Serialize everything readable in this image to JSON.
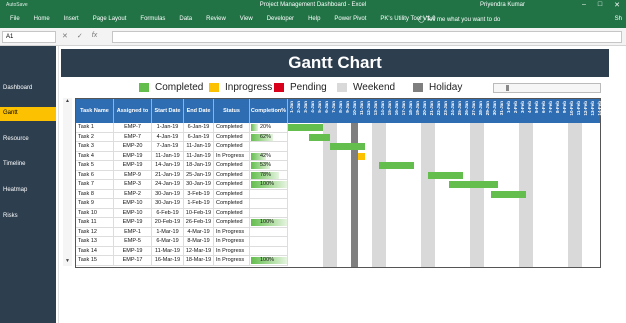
{
  "titlebar": {
    "autosave": "AutoSave",
    "window_title": "Project Management Dashboard - Excel",
    "user": "Priyendra Kumar"
  },
  "ribbon": {
    "tabs": [
      "File",
      "Home",
      "Insert",
      "Page Layout",
      "Formulas",
      "Data",
      "Review",
      "View",
      "Developer",
      "Help",
      "Power Pivot",
      "PK's Utility Tool V1.0"
    ],
    "tell_me": "Tell me what you want to do",
    "share": "Sh"
  },
  "formula_bar": {
    "name_box": "A1",
    "value": ""
  },
  "nav": {
    "items": [
      "Dashboard",
      "Gantt",
      "Resource",
      "Timeline",
      "Heatmap",
      "Risks"
    ],
    "active": 1
  },
  "banner": {
    "title": "Gantt Chart"
  },
  "legend": [
    {
      "label": "Completed",
      "color": "#63be4d"
    },
    {
      "label": "Inprogress",
      "color": "#fcc100"
    },
    {
      "label": "Pending",
      "color": "#d9001b"
    },
    {
      "label": "Weekend",
      "color": "#d9d9d9"
    },
    {
      "label": "Holiday",
      "color": "#7f7f7f"
    }
  ],
  "table": {
    "columns": [
      "Task Name",
      "Assigned to",
      "Start Date",
      "End Date",
      "Status",
      "Completion%"
    ],
    "day_labels": [
      "1-Jan",
      "2-Jan",
      "3-Jan",
      "4-Jan",
      "5-Jan",
      "6-Jan",
      "7-Jan",
      "8-Jan",
      "9-Jan",
      "10-Jan",
      "11-Jan",
      "12-Jan",
      "13-Jan",
      "14-Jan",
      "15-Jan",
      "16-Jan",
      "17-Jan",
      "18-Jan",
      "19-Jan",
      "20-Jan",
      "21-Jan",
      "22-Jan",
      "23-Jan",
      "24-Jan",
      "25-Jan",
      "26-Jan",
      "27-Jan",
      "28-Jan",
      "29-Jan",
      "30-Jan",
      "31-Jan",
      "1-Feb",
      "2-Feb",
      "3-Feb",
      "4-Feb",
      "5-Feb",
      "6-Feb",
      "7-Feb",
      "8-Feb",
      "9-Feb",
      "10-Feb",
      "11-Feb",
      "12-Feb",
      "13-Feb",
      "14-Feb"
    ],
    "weekend_days": [
      5,
      6,
      12,
      13,
      19,
      20,
      26,
      27,
      33,
      34,
      40,
      41
    ],
    "holiday_days": [
      9
    ],
    "rows": [
      {
        "task": "Task 1",
        "assigned": "EMP-7",
        "start": "1-Jan-19",
        "end": "6-Jan-19",
        "status": "Completed",
        "pct": "20%",
        "pct_val": 0.2,
        "bar_start": 0,
        "bar_len": 5,
        "bar_color": "#63be4d"
      },
      {
        "task": "Task 2",
        "assigned": "EMP-7",
        "start": "4-Jan-19",
        "end": "6-Jan-19",
        "status": "Completed",
        "pct": "62%",
        "pct_val": 0.62,
        "bar_start": 3,
        "bar_len": 3,
        "bar_color": "#63be4d"
      },
      {
        "task": "Task 3",
        "assigned": "EMP-20",
        "start": "7-Jan-19",
        "end": "11-Jan-19",
        "status": "Completed",
        "pct": "",
        "pct_val": 0,
        "bar_start": 6,
        "bar_len": 5,
        "bar_color": "#63be4d"
      },
      {
        "task": "Task 4",
        "assigned": "EMP-19",
        "start": "11-Jan-19",
        "end": "11-Jan-19",
        "status": "In Progress",
        "pct": "42%",
        "pct_val": 0.42,
        "bar_start": 10,
        "bar_len": 1,
        "bar_color": "#fcc100"
      },
      {
        "task": "Task 5",
        "assigned": "EMP-19",
        "start": "14-Jan-19",
        "end": "18-Jan-19",
        "status": "Completed",
        "pct": "53%",
        "pct_val": 0.53,
        "bar_start": 13,
        "bar_len": 5,
        "bar_color": "#63be4d"
      },
      {
        "task": "Task 6",
        "assigned": "EMP-9",
        "start": "21-Jan-19",
        "end": "25-Jan-19",
        "status": "Completed",
        "pct": "78%",
        "pct_val": 0.78,
        "bar_start": 20,
        "bar_len": 5,
        "bar_color": "#63be4d"
      },
      {
        "task": "Task 7",
        "assigned": "EMP-3",
        "start": "24-Jan-19",
        "end": "30-Jan-19",
        "status": "Completed",
        "pct": "100%",
        "pct_val": 1.0,
        "bar_start": 23,
        "bar_len": 7,
        "bar_color": "#63be4d"
      },
      {
        "task": "Task 8",
        "assigned": "EMP-2",
        "start": "30-Jan-19",
        "end": "3-Feb-19",
        "status": "Completed",
        "pct": "",
        "pct_val": 0,
        "bar_start": 29,
        "bar_len": 5,
        "bar_color": "#63be4d"
      },
      {
        "task": "Task 9",
        "assigned": "EMP-10",
        "start": "30-Jan-19",
        "end": "1-Feb-19",
        "status": "Completed",
        "pct": "",
        "pct_val": 0,
        "bar_start": 0,
        "bar_len": 0,
        "bar_color": "#63be4d"
      },
      {
        "task": "Task 10",
        "assigned": "EMP-10",
        "start": "6-Feb-19",
        "end": "10-Feb-19",
        "status": "Completed",
        "pct": "",
        "pct_val": 0,
        "bar_start": 0,
        "bar_len": 0,
        "bar_color": "#63be4d"
      },
      {
        "task": "Task 11",
        "assigned": "EMP-19",
        "start": "20-Feb-19",
        "end": "26-Feb-19",
        "status": "Completed",
        "pct": "100%",
        "pct_val": 1.0,
        "bar_start": 0,
        "bar_len": 0,
        "bar_color": "#63be4d"
      },
      {
        "task": "Task 12",
        "assigned": "EMP-1",
        "start": "1-Mar-19",
        "end": "4-Mar-19",
        "status": "In Progress",
        "pct": "",
        "pct_val": 0,
        "bar_start": 0,
        "bar_len": 0,
        "bar_color": "#fcc100"
      },
      {
        "task": "Task 13",
        "assigned": "EMP-5",
        "start": "6-Mar-19",
        "end": "8-Mar-19",
        "status": "In Progress",
        "pct": "",
        "pct_val": 0,
        "bar_start": 0,
        "bar_len": 0,
        "bar_color": "#fcc100"
      },
      {
        "task": "Task 14",
        "assigned": "EMP-19",
        "start": "11-Mar-19",
        "end": "12-Mar-19",
        "status": "In Progress",
        "pct": "",
        "pct_val": 0,
        "bar_start": 0,
        "bar_len": 0,
        "bar_color": "#fcc100"
      },
      {
        "task": "Task 15",
        "assigned": "EMP-17",
        "start": "16-Mar-19",
        "end": "18-Mar-19",
        "status": "In Progress",
        "pct": "100%",
        "pct_val": 1.0,
        "bar_start": 0,
        "bar_len": 0,
        "bar_color": "#fcc100"
      }
    ]
  }
}
